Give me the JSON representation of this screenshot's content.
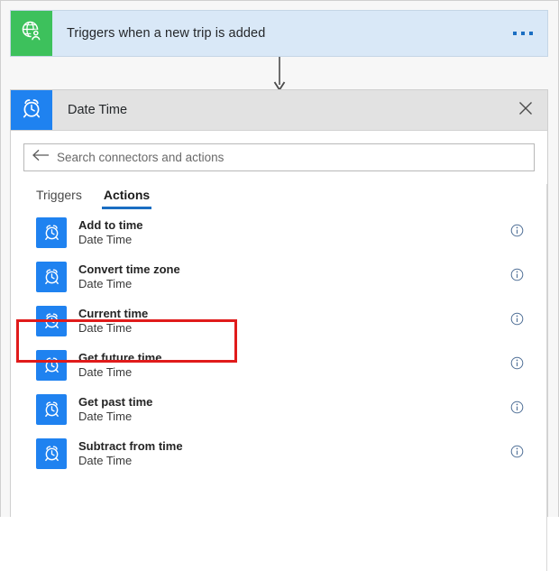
{
  "trigger": {
    "icon": "globe-person-icon",
    "title": "Triggers when a new trip is added",
    "more_label": "…",
    "icon_color": "#3dc15c",
    "bg_color": "#d9e8f7"
  },
  "connector": {
    "icon": "down-arrow-icon"
  },
  "picker": {
    "icon": "alarm-clock-icon",
    "title": "Date Time",
    "close_label": "✕",
    "header_bg": "#e2e2e2",
    "search": {
      "back_icon": "back-arrow-icon",
      "placeholder": "Search connectors and actions",
      "value": ""
    },
    "tabs": [
      {
        "label": "Triggers",
        "active": false
      },
      {
        "label": "Actions",
        "active": true
      }
    ],
    "accent_color": "#1b6ec2",
    "items": [
      {
        "title": "Add to time",
        "subtitle": "Date Time",
        "icon": "alarm-clock-icon",
        "info": "info-icon",
        "highlighted": false
      },
      {
        "title": "Convert time zone",
        "subtitle": "Date Time",
        "icon": "alarm-clock-icon",
        "info": "info-icon",
        "highlighted": false
      },
      {
        "title": "Current time",
        "subtitle": "Date Time",
        "icon": "alarm-clock-icon",
        "info": "info-icon",
        "highlighted": true
      },
      {
        "title": "Get future time",
        "subtitle": "Date Time",
        "icon": "alarm-clock-icon",
        "info": "info-icon",
        "highlighted": false
      },
      {
        "title": "Get past time",
        "subtitle": "Date Time",
        "icon": "alarm-clock-icon",
        "info": "info-icon",
        "highlighted": false
      },
      {
        "title": "Subtract from time",
        "subtitle": "Date Time",
        "icon": "alarm-clock-icon",
        "info": "info-icon",
        "highlighted": false
      }
    ]
  },
  "annotation": {
    "highlight_color": "#e01b1b",
    "target": "Current time"
  }
}
